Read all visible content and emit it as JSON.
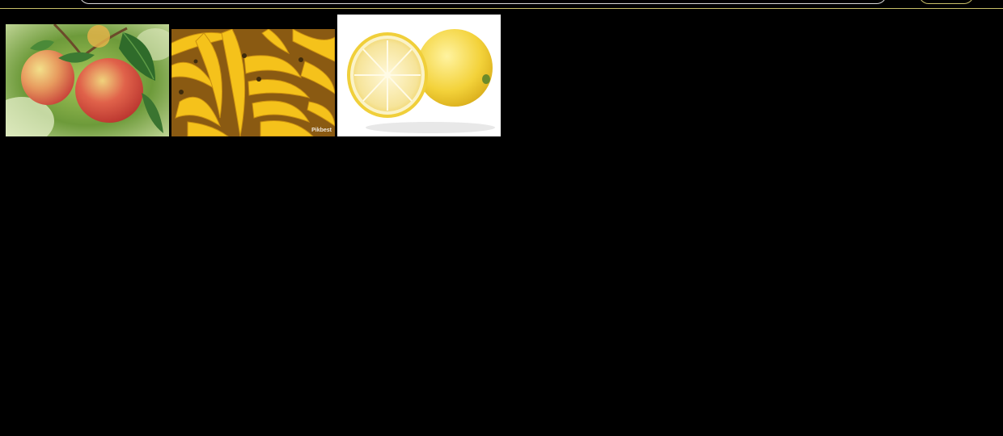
{
  "header": {
    "search_placeholder": "",
    "search_button_label": ""
  },
  "gallery": {
    "images": [
      {
        "name": "apples"
      },
      {
        "name": "bananas",
        "watermark": "Pikbest"
      },
      {
        "name": "lemon"
      }
    ]
  },
  "colors": {
    "background": "#000000",
    "accent": "#c9c06a",
    "search_border": "#d9d9d9"
  }
}
